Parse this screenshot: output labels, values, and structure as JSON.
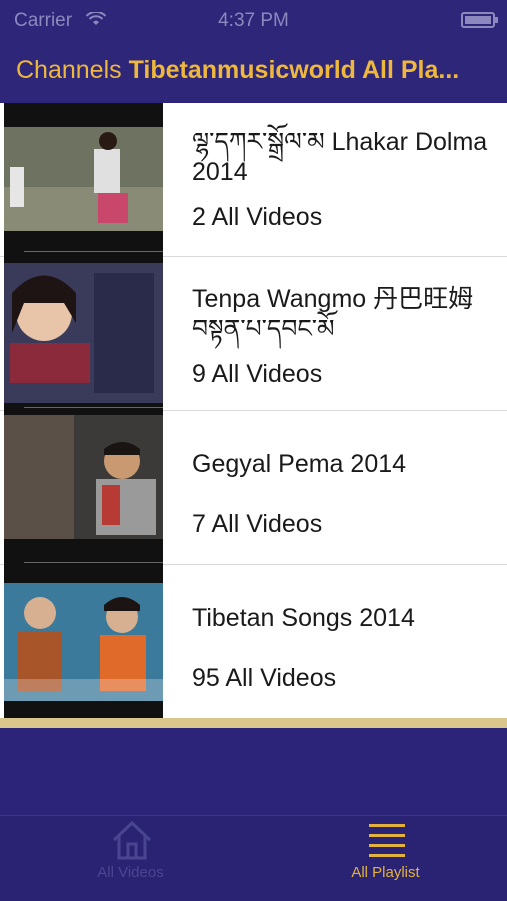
{
  "status_bar": {
    "carrier": "Carrier",
    "time": "4:37 PM"
  },
  "nav": {
    "title_prefix": "Channels",
    "title_main": "Tibetanmusicworld All Pla..."
  },
  "playlists": [
    {
      "title": "ལྷ་དཀར་སྒྲོལ་མ Lhakar Dolma 2014",
      "count": "2 All Videos"
    },
    {
      "title": "Tenpa Wangmo 丹巴旺姆 བསྟན་པ་དབང་མོ",
      "count": "9 All Videos"
    },
    {
      "title": "Gegyal Pema 2014",
      "count": "7 All Videos"
    },
    {
      "title": "Tibetan Songs 2014",
      "count": "95 All Videos"
    }
  ],
  "tabbar": {
    "tabs": [
      {
        "label": "All Videos",
        "icon": "home-icon",
        "active": false
      },
      {
        "label": "All Playlist",
        "icon": "list-icon",
        "active": true
      }
    ]
  },
  "colors": {
    "bar_background": "#2e2679",
    "accent": "#eeb73d",
    "inactive_tab": "#4a4591"
  }
}
